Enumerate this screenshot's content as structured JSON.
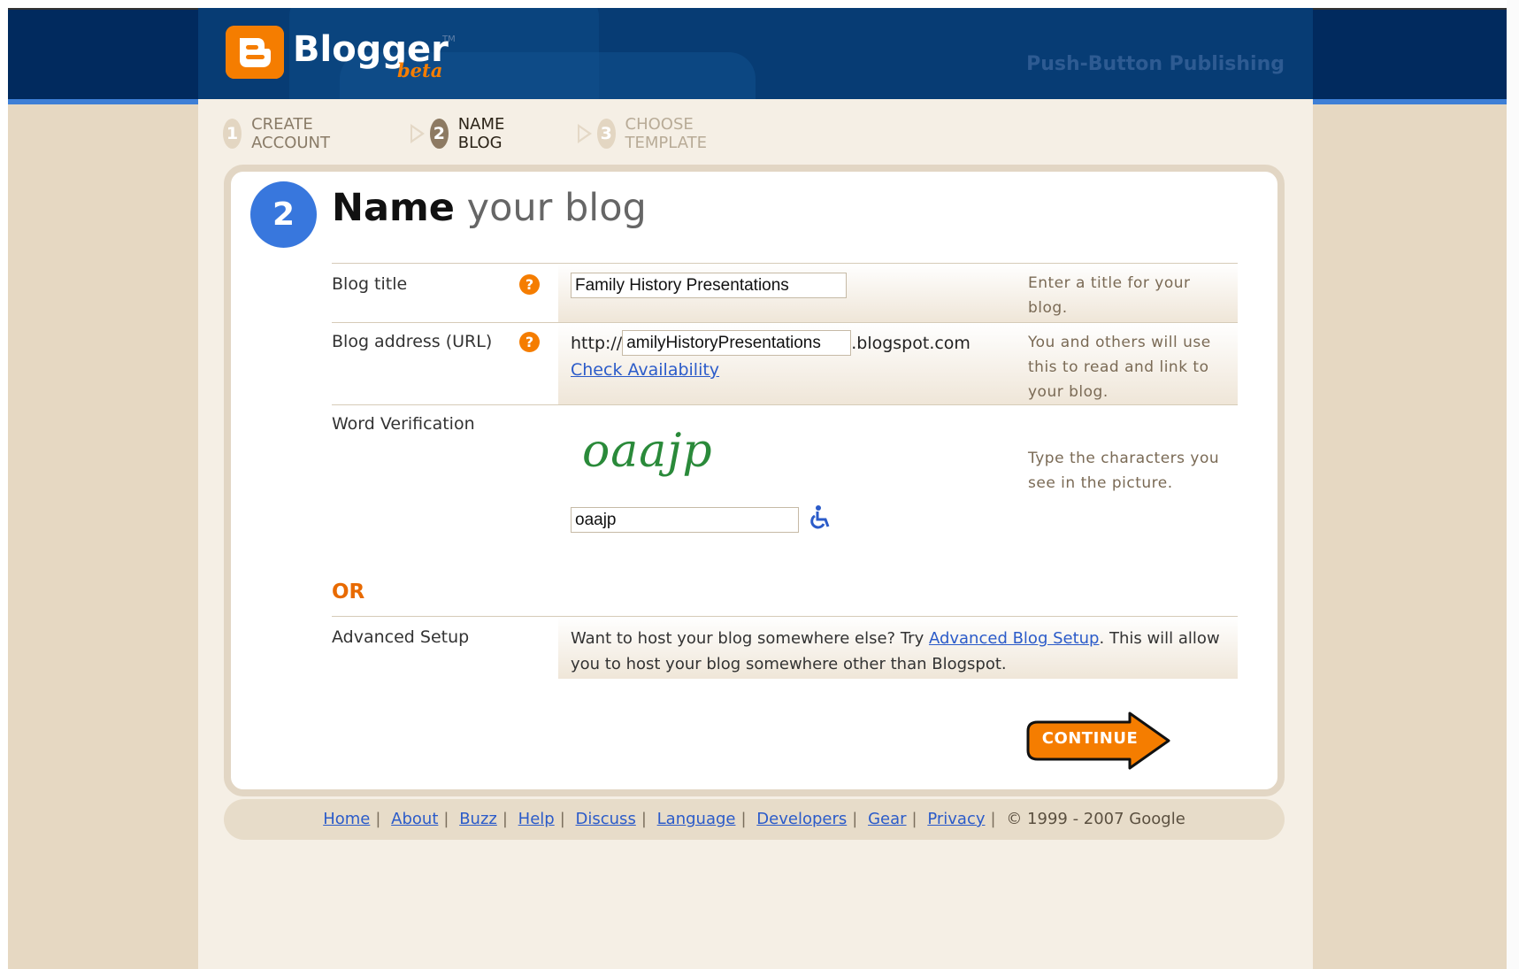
{
  "header": {
    "brand": "Blogger",
    "tm": "TM",
    "beta": "beta",
    "tagline": "Push-Button Publishing",
    "colors": {
      "header_bg": "#012a5e",
      "accent_line": "#3e7fd6",
      "logo_orange": "#f57d00"
    }
  },
  "steps": [
    {
      "num": "1",
      "label": "CREATE ACCOUNT",
      "state": "done"
    },
    {
      "num": "2",
      "label": "NAME BLOG",
      "state": "current"
    },
    {
      "num": "3",
      "label": "CHOOSE TEMPLATE",
      "state": "upcoming"
    }
  ],
  "page": {
    "step_number": "2",
    "title_bold": "Name",
    "title_rest": "your blog"
  },
  "form": {
    "blog_title": {
      "label": "Blog title",
      "help_icon": "?",
      "value": "Family History Presentations",
      "description": "Enter a title for your blog."
    },
    "blog_address": {
      "label": "Blog address (URL)",
      "help_icon": "?",
      "prefix": "http://",
      "value": "amilyHistoryPresentations",
      "suffix": ".blogspot.com",
      "check_link": "Check Availability",
      "description": "You and others will use this to read and link to your blog."
    },
    "word_verification": {
      "label": "Word Verification",
      "captcha_text": "oaajp",
      "value": "oaajp",
      "accessibility_icon": "wheelchair-icon",
      "description": "Type the characters you see in the picture."
    },
    "or_label": "OR",
    "advanced": {
      "label": "Advanced Setup",
      "text_before": "Want to host your blog somewhere else? Try ",
      "link": "Advanced Blog Setup",
      "text_after": ". This will allow you to host your blog somewhere other than Blogspot."
    },
    "continue_label": "CONTINUE"
  },
  "footer": {
    "links": [
      "Home",
      "About",
      "Buzz",
      "Help",
      "Discuss",
      "Language",
      "Developers",
      "Gear",
      "Privacy"
    ],
    "copyright": "© 1999 - 2007 Google"
  }
}
